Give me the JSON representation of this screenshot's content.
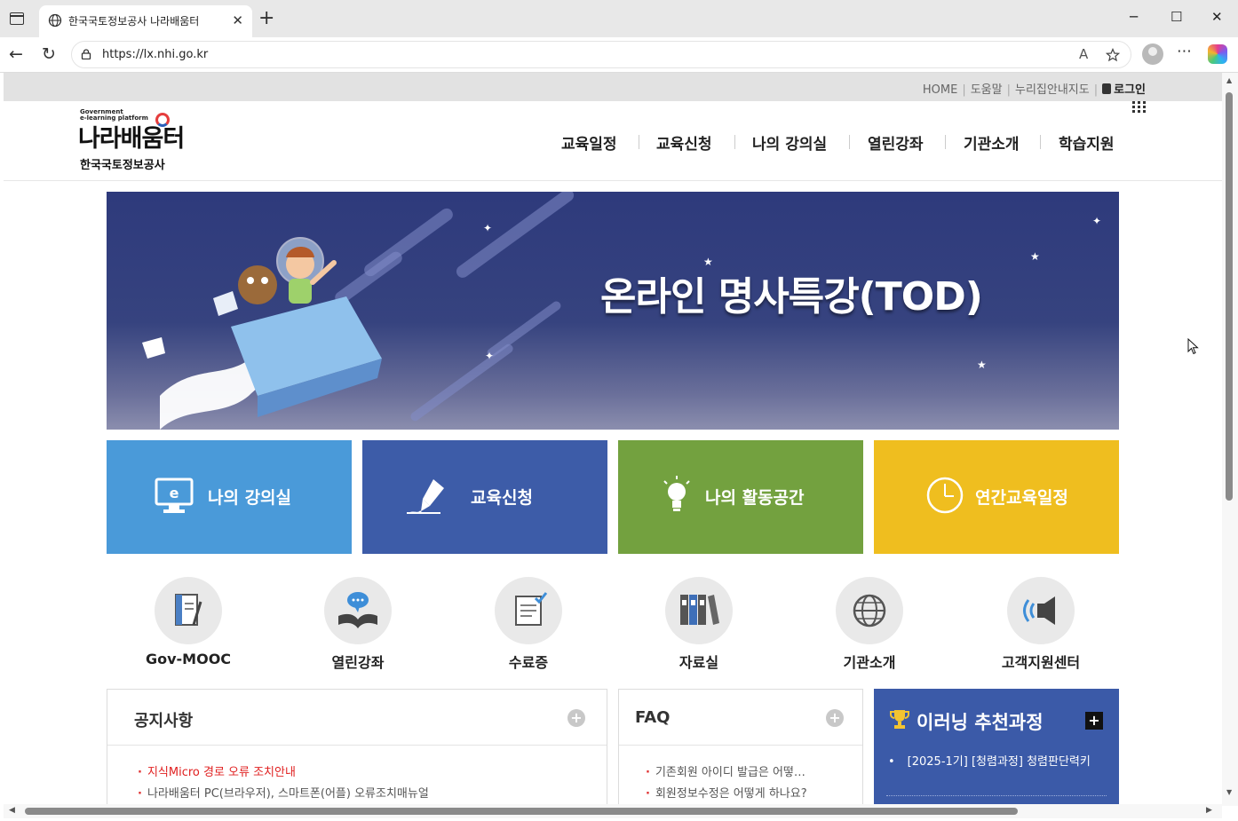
{
  "browser": {
    "tab_title": "한국국토정보공사 나라배움터",
    "tab_close": "✕",
    "new_tab": "+",
    "url": "https://lx.nhi.go.kr",
    "read_aloud": "A",
    "min": "─",
    "max": "☐",
    "close": "✕",
    "more": "⋯",
    "back": "←",
    "refresh": "↻"
  },
  "util": {
    "home": "HOME",
    "help": "도움말",
    "nuri": "누리집안내지도",
    "login": "로그인"
  },
  "logo": {
    "small_line1": "Government",
    "small_line2": "e-learning platform",
    "main": "나라배움터",
    "org": "한국국토정보공사"
  },
  "gnb": [
    "교육일정",
    "교육신청",
    "나의 강의실",
    "열린강좌",
    "기관소개",
    "학습지원"
  ],
  "banner": {
    "title": "온라인 명사특강(TOD)"
  },
  "tiles": [
    {
      "label": "나의 강의실",
      "color": "#4a9ad9",
      "icon": "monitor-icon"
    },
    {
      "label": "교육신청",
      "color": "#3d5ca8",
      "icon": "pen-icon"
    },
    {
      "label": "나의 활동공간",
      "color": "#73a13f",
      "icon": "bulb-icon"
    },
    {
      "label": "연간교육일정",
      "color": "#efbe1f",
      "icon": "clock-icon"
    }
  ],
  "circles": [
    {
      "label": "Gov-MOOC"
    },
    {
      "label": "열린강좌"
    },
    {
      "label": "수료증"
    },
    {
      "label": "자료실"
    },
    {
      "label": "기관소개"
    },
    {
      "label": "고객지원센터"
    }
  ],
  "notice": {
    "title": "공지사항",
    "more": "+",
    "items": [
      "지식Micro 경로 오류 조치안내",
      "나라배움터 PC(브라우저), 스마트폰(어플) 오류조치매뉴얼"
    ]
  },
  "faq": {
    "title": "FAQ",
    "more": "+",
    "items": [
      "기존회원 아이디 발급은 어떻…",
      "회원정보수정은 어떻게 하나요?"
    ]
  },
  "recommend": {
    "title": "이러닝 추천과정",
    "more": "+",
    "items": [
      "[2025-1기] [청렴과정] 청렴판단력키"
    ]
  }
}
